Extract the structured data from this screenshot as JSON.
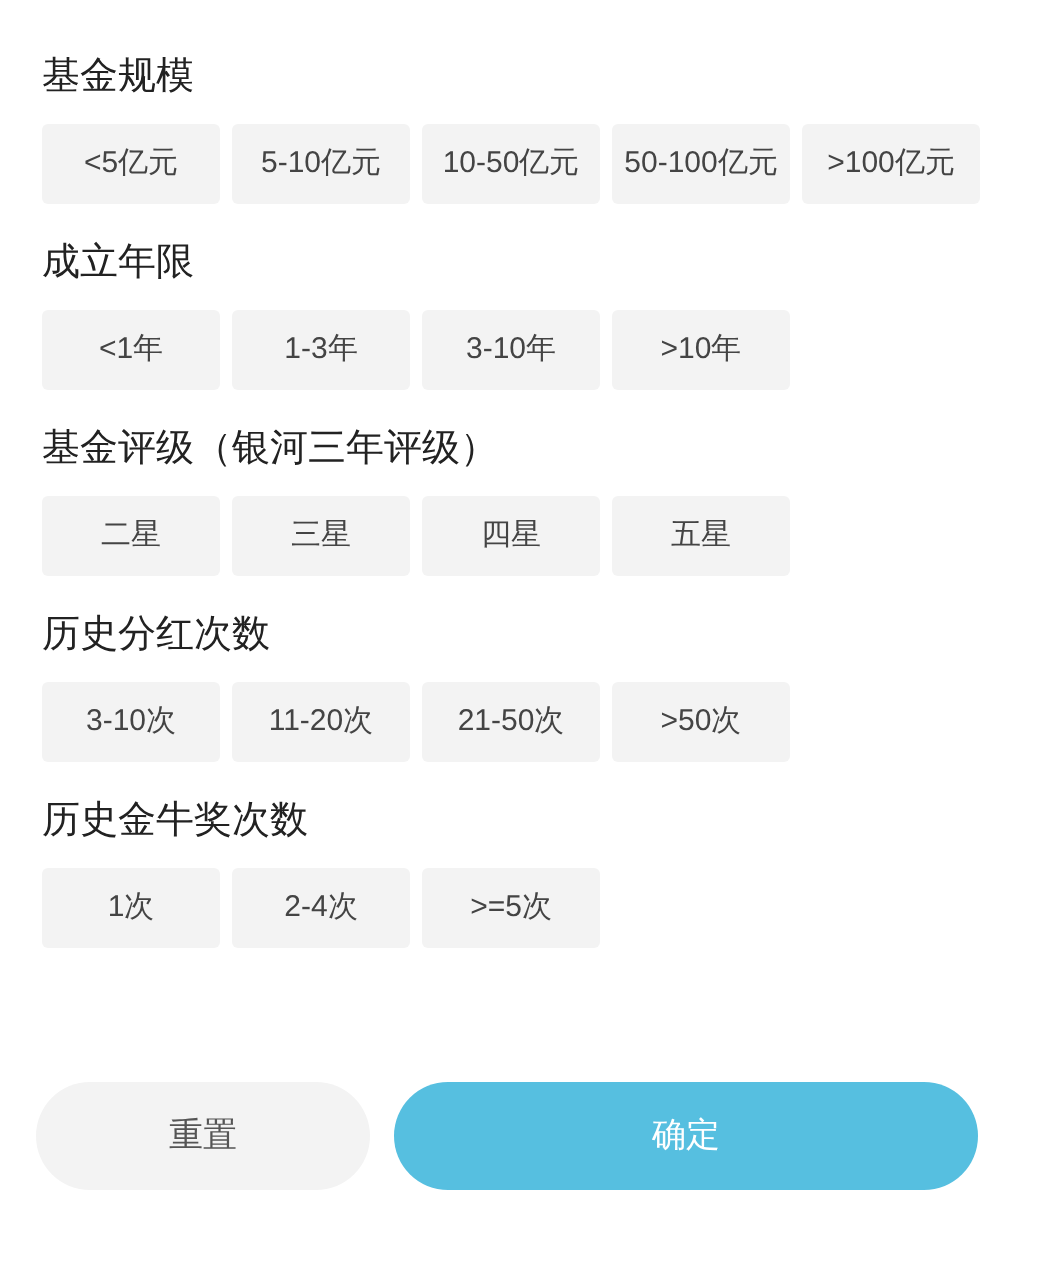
{
  "sections": [
    {
      "title": "基金规模",
      "options": [
        {
          "label": "<5亿元",
          "selected": false
        },
        {
          "label": "5-10亿元",
          "selected": false
        },
        {
          "label": "10-50亿元",
          "selected": false
        },
        {
          "label": "50-100亿元",
          "selected": false
        },
        {
          "label": ">100亿元",
          "selected": false
        }
      ]
    },
    {
      "title": "成立年限",
      "options": [
        {
          "label": "<1年",
          "selected": false
        },
        {
          "label": "1-3年",
          "selected": false
        },
        {
          "label": "3-10年",
          "selected": false
        },
        {
          "label": ">10年",
          "selected": false
        }
      ]
    },
    {
      "title": "基金评级（银河三年评级）",
      "options": [
        {
          "label": "二星",
          "selected": false
        },
        {
          "label": "三星",
          "selected": false
        },
        {
          "label": "四星",
          "selected": false
        },
        {
          "label": "五星",
          "selected": false
        }
      ]
    },
    {
      "title": "历史分红次数",
      "options": [
        {
          "label": "3-10次",
          "selected": false
        },
        {
          "label": "11-20次",
          "selected": false
        },
        {
          "label": "21-50次",
          "selected": false
        },
        {
          "label": ">50次",
          "selected": false
        }
      ]
    },
    {
      "title": "历史金牛奖次数",
      "options": [
        {
          "label": "1次",
          "selected": false
        },
        {
          "label": "2-4次",
          "selected": false
        },
        {
          "label": ">=5次",
          "selected": false
        }
      ]
    }
  ],
  "buttons": {
    "reset": "重置",
    "confirm": "确定"
  }
}
